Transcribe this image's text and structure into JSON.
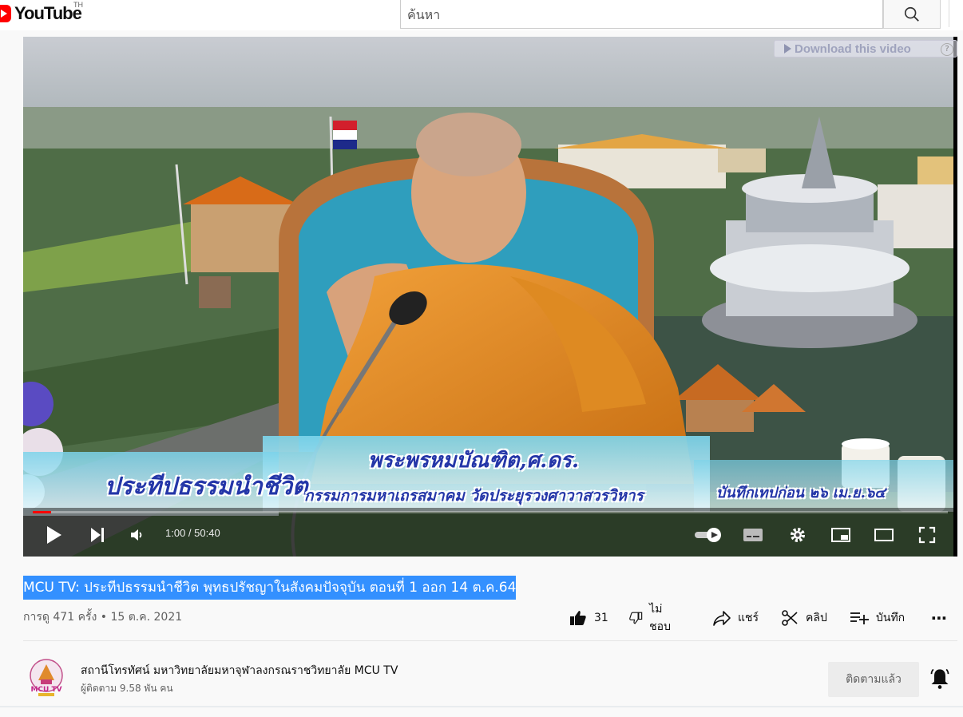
{
  "header": {
    "logo_text": "YouTube",
    "country_code": "TH",
    "search_placeholder": "ค้นหา"
  },
  "player": {
    "download_label": "Download this video",
    "download_help": "?",
    "overlay": {
      "program_title": "ประทีปธรรมนำชีวิต",
      "speaker_name": "พระพรหมบัณฑิต,ศ.ดร.",
      "speaker_role": "กรรมการมหาเถรสมาคม วัดประยุรวงศาวาสวรวิหาร",
      "recorded_note": "บันทึกเทปก่อน ๒๖ เม.ย.๖๔"
    },
    "time_display": "1:00 / 50:40",
    "progress_percent": 1.97,
    "colors": {
      "progress": "#ff0000"
    }
  },
  "video": {
    "title": "MCU TV: ประทีปธรรมนำชีวิต พุทธปรัชญาในสังคมปัจจุบัน ตอนที่ 1 ออก 14 ต.ค.64",
    "views_date": "การดู 471 ครั้ง • 15 ต.ค. 2021",
    "actions": {
      "like_count": "31",
      "dislike_label": "ไม่ชอบ",
      "share_label": "แชร์",
      "clip_label": "คลิป",
      "save_label": "บันทึก",
      "more_label": "⋯"
    }
  },
  "channel": {
    "name": "สถานีโทรทัศน์ มหาวิทยาลัยมหาจุฬาลงกรณราชวิทยาลัย MCU TV",
    "subscribers": "ผู้ติดตาม 9.58 พัน คน",
    "subscribe_label": "ติดตามแล้ว",
    "avatar_text": "MCU TV"
  }
}
